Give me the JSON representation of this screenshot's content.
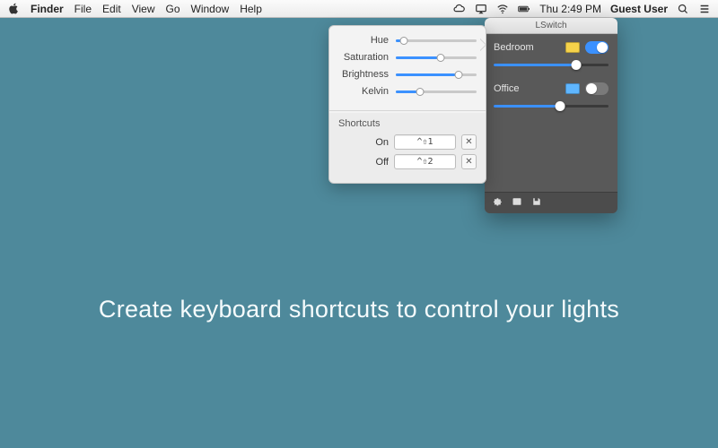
{
  "menubar": {
    "app": "Finder",
    "items": [
      "File",
      "Edit",
      "View",
      "Go",
      "Window",
      "Help"
    ],
    "clock": "Thu 2:49 PM",
    "user": "Guest User"
  },
  "lswitch": {
    "title": "LSwitch",
    "rooms": [
      {
        "name": "Bedroom",
        "color": "#f5d24a",
        "on": true,
        "level": 0.72
      },
      {
        "name": "Office",
        "color": "#5fb6ff",
        "on": false,
        "level": 0.58
      }
    ]
  },
  "popover": {
    "sliders": [
      {
        "label": "Hue",
        "value": 0.1
      },
      {
        "label": "Saturation",
        "value": 0.55
      },
      {
        "label": "Brightness",
        "value": 0.78
      },
      {
        "label": "Kelvin",
        "value": 0.3
      }
    ],
    "shortcuts_heading": "Shortcuts",
    "shortcuts": [
      {
        "label": "On",
        "keys": "^⇧1",
        "clear": "✕"
      },
      {
        "label": "Off",
        "keys": "^⇧2",
        "clear": "✕"
      }
    ]
  },
  "tagline": "Create keyboard shortcuts to control your lights"
}
